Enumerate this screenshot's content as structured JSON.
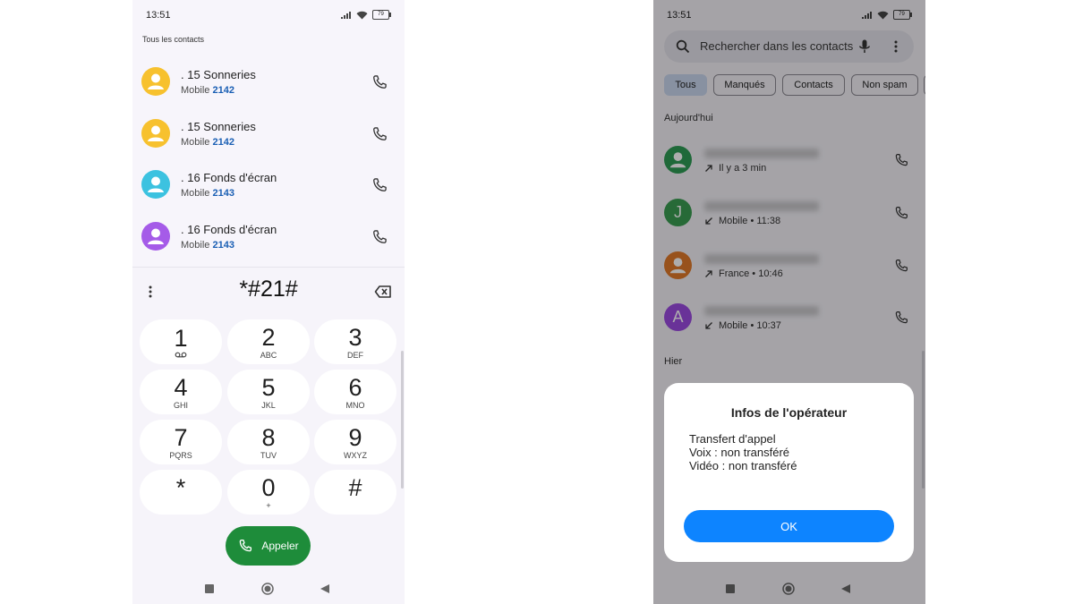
{
  "left_phone": {
    "status": {
      "time": "13:51",
      "battery": "79"
    },
    "section_label": "Tous les contacts",
    "contacts": [
      {
        "name": ". 15 Sonneries",
        "type": "Mobile",
        "number_match": "2142",
        "avatar_color": "#f7c12e"
      },
      {
        "name": ". 15 Sonneries",
        "type": "Mobile",
        "number_match": "2142",
        "avatar_color": "#f7c12e"
      },
      {
        "name": ". 16 Fonds d'écran",
        "type": "Mobile",
        "number_match": "2143",
        "avatar_color": "#3cc2e0"
      },
      {
        "name": ". 16 Fonds d'écran",
        "type": "Mobile",
        "number_match": "2143",
        "avatar_color": "#a55be8"
      }
    ],
    "dialer": {
      "number": "*#21#",
      "keys": [
        {
          "digit": "1",
          "letters": ""
        },
        {
          "digit": "2",
          "letters": "ABC"
        },
        {
          "digit": "3",
          "letters": "DEF"
        },
        {
          "digit": "4",
          "letters": "GHI"
        },
        {
          "digit": "5",
          "letters": "JKL"
        },
        {
          "digit": "6",
          "letters": "MNO"
        },
        {
          "digit": "7",
          "letters": "PQRS"
        },
        {
          "digit": "8",
          "letters": "TUV"
        },
        {
          "digit": "9",
          "letters": "WXYZ"
        },
        {
          "digit": "*",
          "letters": ""
        },
        {
          "digit": "0",
          "letters": "+"
        },
        {
          "digit": "#",
          "letters": ""
        }
      ],
      "call_label": "Appeler",
      "call_color": "#1e8c3a"
    }
  },
  "right_phone": {
    "status": {
      "time": "13:51",
      "battery": "79"
    },
    "search_placeholder": "Rechercher dans les contacts",
    "filters": [
      {
        "label": "Tous",
        "selected": true
      },
      {
        "label": "Manqués",
        "selected": false
      },
      {
        "label": "Contacts",
        "selected": false
      },
      {
        "label": "Non spam",
        "selected": false
      }
    ],
    "today_label": "Aujourd'hui",
    "calls": [
      {
        "name": "",
        "initial": "",
        "direction": "outgoing",
        "meta": "Il y a 3 min",
        "avatar_color": "#2e9b55"
      },
      {
        "name": "",
        "initial": "J",
        "direction": "incoming",
        "meta": "Mobile • 11:38",
        "avatar_color": "#3a9d52"
      },
      {
        "name": "",
        "initial": "",
        "direction": "outgoing",
        "meta": "France • 10:46",
        "avatar_color": "#e07a2a"
      },
      {
        "name": "",
        "initial": "A",
        "direction": "incoming",
        "meta": "Mobile • 10:37",
        "avatar_color": "#9b4be0"
      }
    ],
    "yesterday_label": "Hier",
    "dialog": {
      "title": "Infos de l'opérateur",
      "lines": [
        "Transfert d'appel",
        "Voix : non transféré",
        "Vidéo : non transféré"
      ],
      "ok_label": "OK",
      "ok_color": "#0d84ff"
    }
  }
}
